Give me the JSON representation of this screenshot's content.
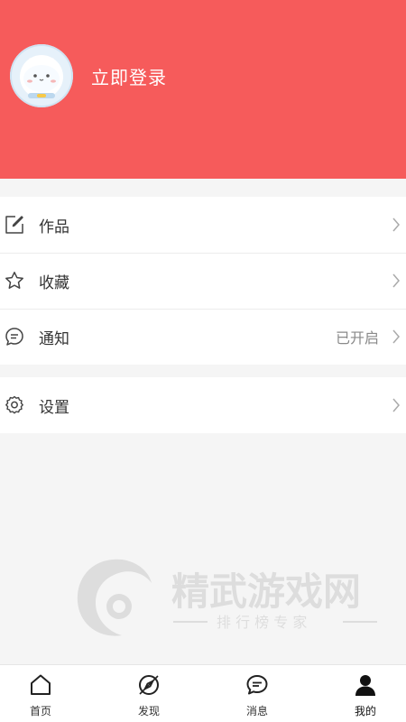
{
  "header": {
    "login_label": "立即登录",
    "background_color": "#f65b5b"
  },
  "menu": {
    "items": [
      {
        "label": "作品",
        "icon": "edit-icon"
      },
      {
        "label": "收藏",
        "icon": "star-icon"
      },
      {
        "label": "通知",
        "icon": "message-icon",
        "status": "已开启"
      }
    ],
    "settings": {
      "label": "设置",
      "icon": "gear-icon"
    }
  },
  "watermark": {
    "title": "精武游戏网",
    "subtitle": "排 行 榜 专 家"
  },
  "tabbar": {
    "tabs": [
      {
        "label": "首页",
        "icon": "home-icon"
      },
      {
        "label": "发现",
        "icon": "compass-icon"
      },
      {
        "label": "消息",
        "icon": "chat-icon"
      },
      {
        "label": "我的",
        "icon": "user-icon",
        "active": true
      }
    ]
  }
}
